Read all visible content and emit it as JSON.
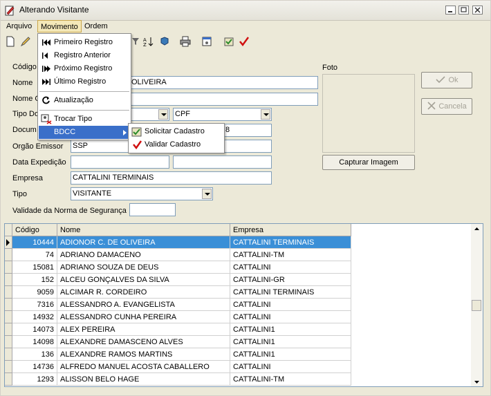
{
  "window": {
    "title": "Alterando Visitante"
  },
  "menu": {
    "items": [
      "Arquivo",
      "Movimento",
      "Ordem"
    ]
  },
  "movimento_menu": {
    "items": [
      "Primeiro Registro",
      "Registro Anterior",
      "Próximo Registro",
      "Último Registro",
      "Atualização",
      "Trocar Tipo",
      "BDCC"
    ]
  },
  "bdcc_submenu": {
    "items": [
      "Solicitar Cadastro",
      "Validar Cadastro"
    ]
  },
  "form": {
    "labels": {
      "codigo": "Código",
      "nome": "Nome",
      "nome2": "Nome C",
      "tipo_doc": "Tipo Do",
      "documento": "Docum",
      "orgao": "Orgão Emissor",
      "expedicao": "Data Expedição",
      "empresa": "Empresa",
      "tipo": "Tipo",
      "validade": "Validade da Norma de Segurança",
      "foto": "Foto"
    },
    "values": {
      "nome": "OLIVEIRA",
      "tipo_doc2": "CPF",
      "documento_tail": "8",
      "orgao": "SSP",
      "empresa": "CATTALINI TERMINAIS",
      "tipo": "VISITANTE"
    },
    "buttons": {
      "ok": "Ok",
      "cancel": "Cancela",
      "capture": "Capturar Imagem"
    }
  },
  "grid": {
    "columns": [
      "Código",
      "Nome",
      "Empresa"
    ],
    "rows": [
      {
        "codigo": "10444",
        "nome": "ADIONOR C. DE OLIVEIRA",
        "empresa": "CATTALINI TERMINAIS"
      },
      {
        "codigo": "74",
        "nome": "ADRIANO DAMACENO",
        "empresa": "CATTALINI-TM"
      },
      {
        "codigo": "15081",
        "nome": "ADRIANO SOUZA DE DEUS",
        "empresa": "CATTALINI"
      },
      {
        "codigo": "152",
        "nome": "ALCEU GONÇALVES DA SILVA",
        "empresa": "CATTALINI-GR"
      },
      {
        "codigo": "9059",
        "nome": "ALCIMAR R. CORDEIRO",
        "empresa": "CATTALINI TERMINAIS"
      },
      {
        "codigo": "7316",
        "nome": "ALESSANDRO A. EVANGELISTA",
        "empresa": "CATTALINI"
      },
      {
        "codigo": "14932",
        "nome": "ALESSANDRO CUNHA PEREIRA",
        "empresa": "CATTALINI"
      },
      {
        "codigo": "14073",
        "nome": "ALEX PEREIRA",
        "empresa": "CATTALINI1"
      },
      {
        "codigo": "14098",
        "nome": "ALEXANDRE DAMASCENO ALVES",
        "empresa": "CATTALINI1"
      },
      {
        "codigo": "136",
        "nome": "ALEXANDRE RAMOS MARTINS",
        "empresa": "CATTALINI1"
      },
      {
        "codigo": "14736",
        "nome": "ALFREDO MANUEL ACOSTA CABALLERO",
        "empresa": "CATTALINI"
      },
      {
        "codigo": "1293",
        "nome": "ALISSON BELO HAGE",
        "empresa": "CATTALINI-TM"
      }
    ]
  },
  "colors": {
    "selection": "#3a8fd7",
    "menu_highlight": "#3a6fc9",
    "check_red": "#d01010"
  }
}
